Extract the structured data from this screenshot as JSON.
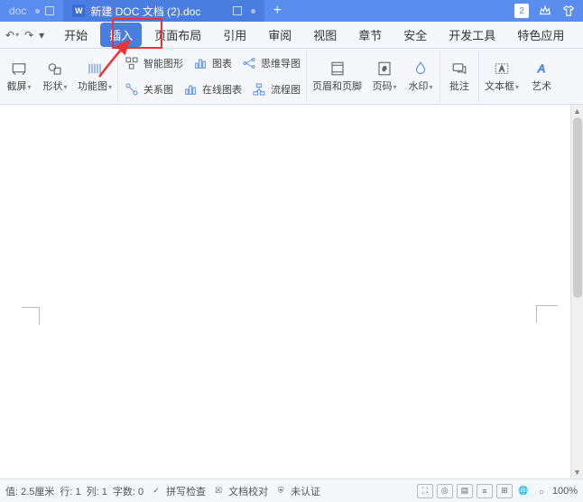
{
  "title_bar": {
    "tabs": [
      {
        "label": "doc"
      },
      {
        "label": "新建 DOC 文档 (2).doc",
        "active": true
      }
    ],
    "badge": "2"
  },
  "menu": {
    "items": [
      "开始",
      "插入",
      "页面布局",
      "引用",
      "审阅",
      "视图",
      "章节",
      "安全",
      "开发工具",
      "特色应用"
    ],
    "active_index": 1
  },
  "ribbon": {
    "g1": {
      "jieping": "截屏",
      "xingzhuang": "形状",
      "gongneng": "功能图"
    },
    "g2": {
      "zhituxing": "智能图形",
      "guanxi": "关系图",
      "tubiao": "图表",
      "zaixian": "在线图表",
      "siwei": "思维导图",
      "liucheng": "流程图"
    },
    "g3": {
      "yemei": "页眉和页脚",
      "yema": "页码",
      "shuiyin": "水印"
    },
    "g4": {
      "pizhu": "批注"
    },
    "g5": {
      "wenbenkuang": "文本框",
      "yishu": "艺术"
    }
  },
  "status": {
    "zhi": "值: 2.5厘米",
    "hang": "行: 1",
    "lie": "列: 1",
    "zishu": "字数: 0",
    "pinxie": "拼写检查",
    "jiaodui": "文档校对",
    "renzheng": "未认证",
    "zoom": "100%"
  }
}
